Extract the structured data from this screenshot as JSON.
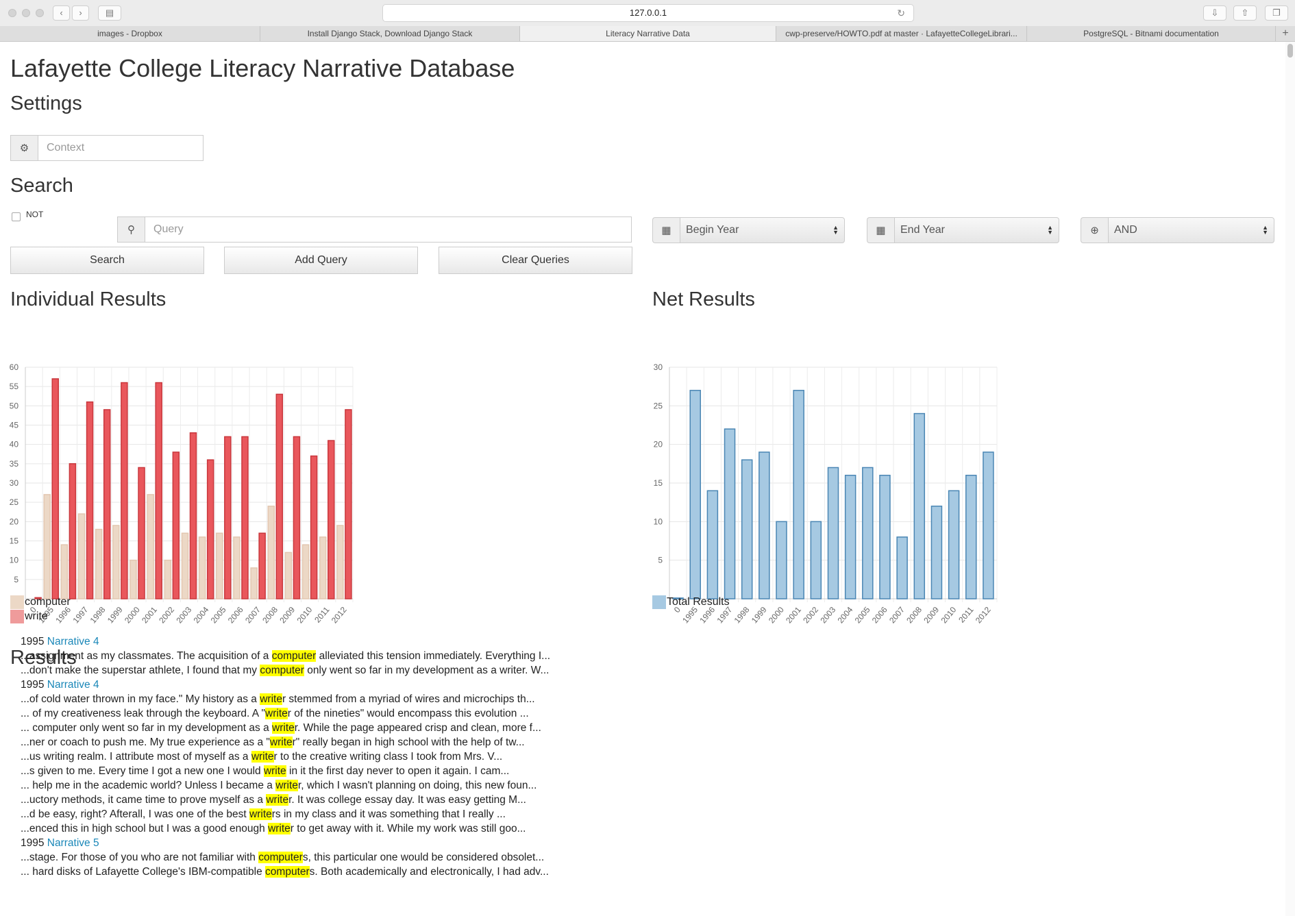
{
  "browser": {
    "url": "127.0.0.1",
    "tabs": [
      {
        "label": "images - Dropbox",
        "active": false
      },
      {
        "label": "Install Django Stack, Download Django Stack",
        "active": false
      },
      {
        "label": "Literacy Narrative Data",
        "active": true
      },
      {
        "label": "cwp-preserve/HOWTO.pdf at master · LafayetteCollegeLibrari...",
        "active": false
      },
      {
        "label": "PostgreSQL - Bitnami documentation",
        "active": false
      }
    ]
  },
  "page": {
    "title": "Lafayette College Literacy Narrative Database",
    "settings_heading": "Settings",
    "context_placeholder": "Context",
    "search_heading": "Search",
    "not_label": "NOT",
    "query_placeholder": "Query",
    "begin_year": "Begin Year",
    "end_year": "End Year",
    "operator": "AND",
    "buttons": {
      "search": "Search",
      "add_query": "Add Query",
      "clear_queries": "Clear Queries"
    },
    "individual_heading": "Individual Results",
    "net_heading": "Net Results",
    "results_heading": "Results"
  },
  "colors": {
    "computer": "#ecd8c6",
    "write": "#e9575c",
    "total": "#a6c9e2",
    "link": "#1a87b8",
    "highlight": "#ffff00"
  },
  "chart_data": [
    {
      "type": "bar",
      "categories": [
        "0",
        "1995",
        "1996",
        "1997",
        "1998",
        "1999",
        "2000",
        "2001",
        "2002",
        "2003",
        "2004",
        "2005",
        "2006",
        "2007",
        "2008",
        "2009",
        "2010",
        "2011",
        "2012"
      ],
      "series": [
        {
          "name": "computer",
          "values": [
            0,
            27,
            14,
            22,
            18,
            19,
            10,
            27,
            10,
            17,
            16,
            17,
            16,
            8,
            24,
            12,
            14,
            16,
            19
          ]
        },
        {
          "name": "write",
          "values": [
            0.3,
            57,
            35,
            51,
            49,
            56,
            34,
            56,
            38,
            43,
            36,
            42,
            42,
            17,
            53,
            42,
            37,
            41,
            49
          ]
        }
      ],
      "yticks": [
        0,
        5,
        10,
        15,
        20,
        25,
        30,
        35,
        40,
        45,
        50,
        55,
        60
      ],
      "ylim": [
        0,
        60
      ],
      "grid": true,
      "legend": "bottom-left"
    },
    {
      "type": "bar",
      "categories": [
        "0",
        "1995",
        "1996",
        "1997",
        "1998",
        "1999",
        "2000",
        "2001",
        "2002",
        "2003",
        "2004",
        "2005",
        "2006",
        "2007",
        "2008",
        "2009",
        "2010",
        "2011",
        "2012"
      ],
      "series": [
        {
          "name": "Total Results",
          "values": [
            0.1,
            27,
            14,
            22,
            18,
            19,
            10,
            27,
            10,
            17,
            16,
            17,
            16,
            8,
            24,
            12,
            14,
            16,
            19
          ]
        }
      ],
      "yticks": [
        0,
        5,
        10,
        15,
        20,
        25,
        30
      ],
      "ylim": [
        0,
        30
      ],
      "grid": true,
      "legend": "bottom-left"
    }
  ],
  "results": [
    {
      "year": "1995",
      "narrative": "Narrative 4",
      "snippets": [
        {
          "pre": "...assignment as my classmates. The acquisition of a ",
          "hl": "computer",
          "post": " alleviated this tension immediately. Everything I..."
        },
        {
          "pre": "...don't make the superstar athlete, I found that my ",
          "hl": "computer",
          "post": " only went so far in my development as a writer. W..."
        }
      ]
    },
    {
      "year": "1995",
      "narrative": "Narrative 4",
      "snippets": [
        {
          "pre": "...of cold water thrown in my face.\" My history as a ",
          "hl": "write",
          "post": "r stemmed from a myriad of wires and microchips th..."
        },
        {
          "pre": "... of my creativeness leak through the keyboard. A \"",
          "hl": "write",
          "post": "r of the nineties\" would encompass this evolution ..."
        },
        {
          "pre": "... computer only went so far in my development as a ",
          "hl": "write",
          "post": "r. While the page appeared crisp and clean, more f..."
        },
        {
          "pre": "...ner or coach to push me. My true experience as a \"",
          "hl": "write",
          "post": "r\" really began in high school with the help of tw..."
        },
        {
          "pre": "...us writing realm. I attribute most of myself as a ",
          "hl": "write",
          "post": "r to the creative writing class I took from Mrs. V..."
        },
        {
          "pre": "...s given to me. Every time I got a new one I would ",
          "hl": "write",
          "post": " in it the first day never to open it again. I cam..."
        },
        {
          "pre": "... help me in the academic world? Unless I became a ",
          "hl": "write",
          "post": "r, which I wasn't planning on doing, this new foun..."
        },
        {
          "pre": "...uctory methods, it came time to prove myself as a ",
          "hl": "write",
          "post": "r. It was college essay day. It was easy getting M..."
        },
        {
          "pre": "...d be easy, right? Afterall, I was one of the best ",
          "hl": "write",
          "post": "rs in my class and it was something that I really ..."
        },
        {
          "pre": "...enced this in high school but I was a good enough ",
          "hl": "write",
          "post": "r to get away with it. While my work was still goo..."
        }
      ]
    },
    {
      "year": "1995",
      "narrative": "Narrative 5",
      "snippets": [
        {
          "pre": "...stage. For those of you who are not familiar with ",
          "hl": "computer",
          "post": "s, this particular one would be considered obsolet..."
        },
        {
          "pre": "... hard disks of Lafayette College's IBM-compatible ",
          "hl": "computer",
          "post": "s. Both academically and electronically, I had adv..."
        }
      ]
    }
  ]
}
